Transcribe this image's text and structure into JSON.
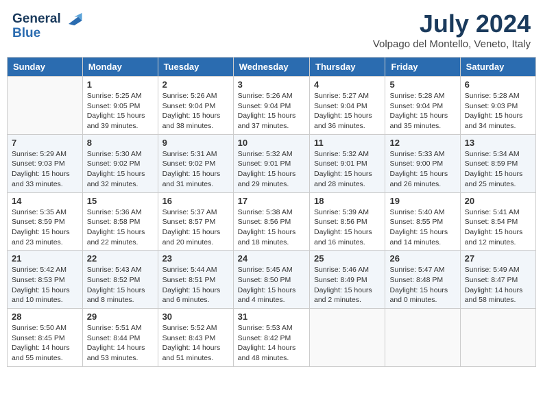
{
  "header": {
    "logo_line1": "General",
    "logo_line2": "Blue",
    "month": "July 2024",
    "location": "Volpago del Montello, Veneto, Italy"
  },
  "weekdays": [
    "Sunday",
    "Monday",
    "Tuesday",
    "Wednesday",
    "Thursday",
    "Friday",
    "Saturday"
  ],
  "weeks": [
    [
      {
        "day": "",
        "sunrise": "",
        "sunset": "",
        "daylight": ""
      },
      {
        "day": "1",
        "sunrise": "Sunrise: 5:25 AM",
        "sunset": "Sunset: 9:05 PM",
        "daylight": "Daylight: 15 hours and 39 minutes."
      },
      {
        "day": "2",
        "sunrise": "Sunrise: 5:26 AM",
        "sunset": "Sunset: 9:04 PM",
        "daylight": "Daylight: 15 hours and 38 minutes."
      },
      {
        "day": "3",
        "sunrise": "Sunrise: 5:26 AM",
        "sunset": "Sunset: 9:04 PM",
        "daylight": "Daylight: 15 hours and 37 minutes."
      },
      {
        "day": "4",
        "sunrise": "Sunrise: 5:27 AM",
        "sunset": "Sunset: 9:04 PM",
        "daylight": "Daylight: 15 hours and 36 minutes."
      },
      {
        "day": "5",
        "sunrise": "Sunrise: 5:28 AM",
        "sunset": "Sunset: 9:04 PM",
        "daylight": "Daylight: 15 hours and 35 minutes."
      },
      {
        "day": "6",
        "sunrise": "Sunrise: 5:28 AM",
        "sunset": "Sunset: 9:03 PM",
        "daylight": "Daylight: 15 hours and 34 minutes."
      }
    ],
    [
      {
        "day": "7",
        "sunrise": "Sunrise: 5:29 AM",
        "sunset": "Sunset: 9:03 PM",
        "daylight": "Daylight: 15 hours and 33 minutes."
      },
      {
        "day": "8",
        "sunrise": "Sunrise: 5:30 AM",
        "sunset": "Sunset: 9:02 PM",
        "daylight": "Daylight: 15 hours and 32 minutes."
      },
      {
        "day": "9",
        "sunrise": "Sunrise: 5:31 AM",
        "sunset": "Sunset: 9:02 PM",
        "daylight": "Daylight: 15 hours and 31 minutes."
      },
      {
        "day": "10",
        "sunrise": "Sunrise: 5:32 AM",
        "sunset": "Sunset: 9:01 PM",
        "daylight": "Daylight: 15 hours and 29 minutes."
      },
      {
        "day": "11",
        "sunrise": "Sunrise: 5:32 AM",
        "sunset": "Sunset: 9:01 PM",
        "daylight": "Daylight: 15 hours and 28 minutes."
      },
      {
        "day": "12",
        "sunrise": "Sunrise: 5:33 AM",
        "sunset": "Sunset: 9:00 PM",
        "daylight": "Daylight: 15 hours and 26 minutes."
      },
      {
        "day": "13",
        "sunrise": "Sunrise: 5:34 AM",
        "sunset": "Sunset: 8:59 PM",
        "daylight": "Daylight: 15 hours and 25 minutes."
      }
    ],
    [
      {
        "day": "14",
        "sunrise": "Sunrise: 5:35 AM",
        "sunset": "Sunset: 8:59 PM",
        "daylight": "Daylight: 15 hours and 23 minutes."
      },
      {
        "day": "15",
        "sunrise": "Sunrise: 5:36 AM",
        "sunset": "Sunset: 8:58 PM",
        "daylight": "Daylight: 15 hours and 22 minutes."
      },
      {
        "day": "16",
        "sunrise": "Sunrise: 5:37 AM",
        "sunset": "Sunset: 8:57 PM",
        "daylight": "Daylight: 15 hours and 20 minutes."
      },
      {
        "day": "17",
        "sunrise": "Sunrise: 5:38 AM",
        "sunset": "Sunset: 8:56 PM",
        "daylight": "Daylight: 15 hours and 18 minutes."
      },
      {
        "day": "18",
        "sunrise": "Sunrise: 5:39 AM",
        "sunset": "Sunset: 8:56 PM",
        "daylight": "Daylight: 15 hours and 16 minutes."
      },
      {
        "day": "19",
        "sunrise": "Sunrise: 5:40 AM",
        "sunset": "Sunset: 8:55 PM",
        "daylight": "Daylight: 15 hours and 14 minutes."
      },
      {
        "day": "20",
        "sunrise": "Sunrise: 5:41 AM",
        "sunset": "Sunset: 8:54 PM",
        "daylight": "Daylight: 15 hours and 12 minutes."
      }
    ],
    [
      {
        "day": "21",
        "sunrise": "Sunrise: 5:42 AM",
        "sunset": "Sunset: 8:53 PM",
        "daylight": "Daylight: 15 hours and 10 minutes."
      },
      {
        "day": "22",
        "sunrise": "Sunrise: 5:43 AM",
        "sunset": "Sunset: 8:52 PM",
        "daylight": "Daylight: 15 hours and 8 minutes."
      },
      {
        "day": "23",
        "sunrise": "Sunrise: 5:44 AM",
        "sunset": "Sunset: 8:51 PM",
        "daylight": "Daylight: 15 hours and 6 minutes."
      },
      {
        "day": "24",
        "sunrise": "Sunrise: 5:45 AM",
        "sunset": "Sunset: 8:50 PM",
        "daylight": "Daylight: 15 hours and 4 minutes."
      },
      {
        "day": "25",
        "sunrise": "Sunrise: 5:46 AM",
        "sunset": "Sunset: 8:49 PM",
        "daylight": "Daylight: 15 hours and 2 minutes."
      },
      {
        "day": "26",
        "sunrise": "Sunrise: 5:47 AM",
        "sunset": "Sunset: 8:48 PM",
        "daylight": "Daylight: 15 hours and 0 minutes."
      },
      {
        "day": "27",
        "sunrise": "Sunrise: 5:49 AM",
        "sunset": "Sunset: 8:47 PM",
        "daylight": "Daylight: 14 hours and 58 minutes."
      }
    ],
    [
      {
        "day": "28",
        "sunrise": "Sunrise: 5:50 AM",
        "sunset": "Sunset: 8:45 PM",
        "daylight": "Daylight: 14 hours and 55 minutes."
      },
      {
        "day": "29",
        "sunrise": "Sunrise: 5:51 AM",
        "sunset": "Sunset: 8:44 PM",
        "daylight": "Daylight: 14 hours and 53 minutes."
      },
      {
        "day": "30",
        "sunrise": "Sunrise: 5:52 AM",
        "sunset": "Sunset: 8:43 PM",
        "daylight": "Daylight: 14 hours and 51 minutes."
      },
      {
        "day": "31",
        "sunrise": "Sunrise: 5:53 AM",
        "sunset": "Sunset: 8:42 PM",
        "daylight": "Daylight: 14 hours and 48 minutes."
      },
      {
        "day": "",
        "sunrise": "",
        "sunset": "",
        "daylight": ""
      },
      {
        "day": "",
        "sunrise": "",
        "sunset": "",
        "daylight": ""
      },
      {
        "day": "",
        "sunrise": "",
        "sunset": "",
        "daylight": ""
      }
    ]
  ]
}
